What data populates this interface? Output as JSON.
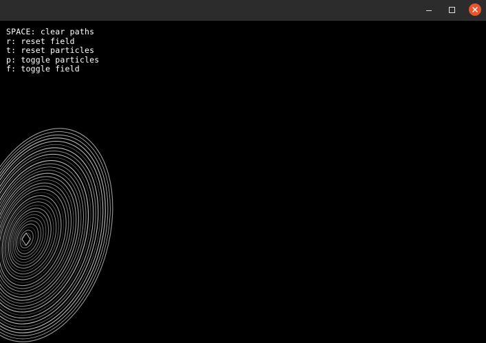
{
  "window": {
    "controls": {
      "minimize_icon": "minimize-icon",
      "maximize_icon": "maximize-icon",
      "close_icon": "close-icon",
      "close_color": "#e9542d"
    }
  },
  "canvas": {
    "background_color": "#000000",
    "help_lines": [
      "SPACE: clear paths",
      "r: reset field",
      "t: reset particles",
      "p: toggle particles",
      "f: toggle field"
    ]
  }
}
